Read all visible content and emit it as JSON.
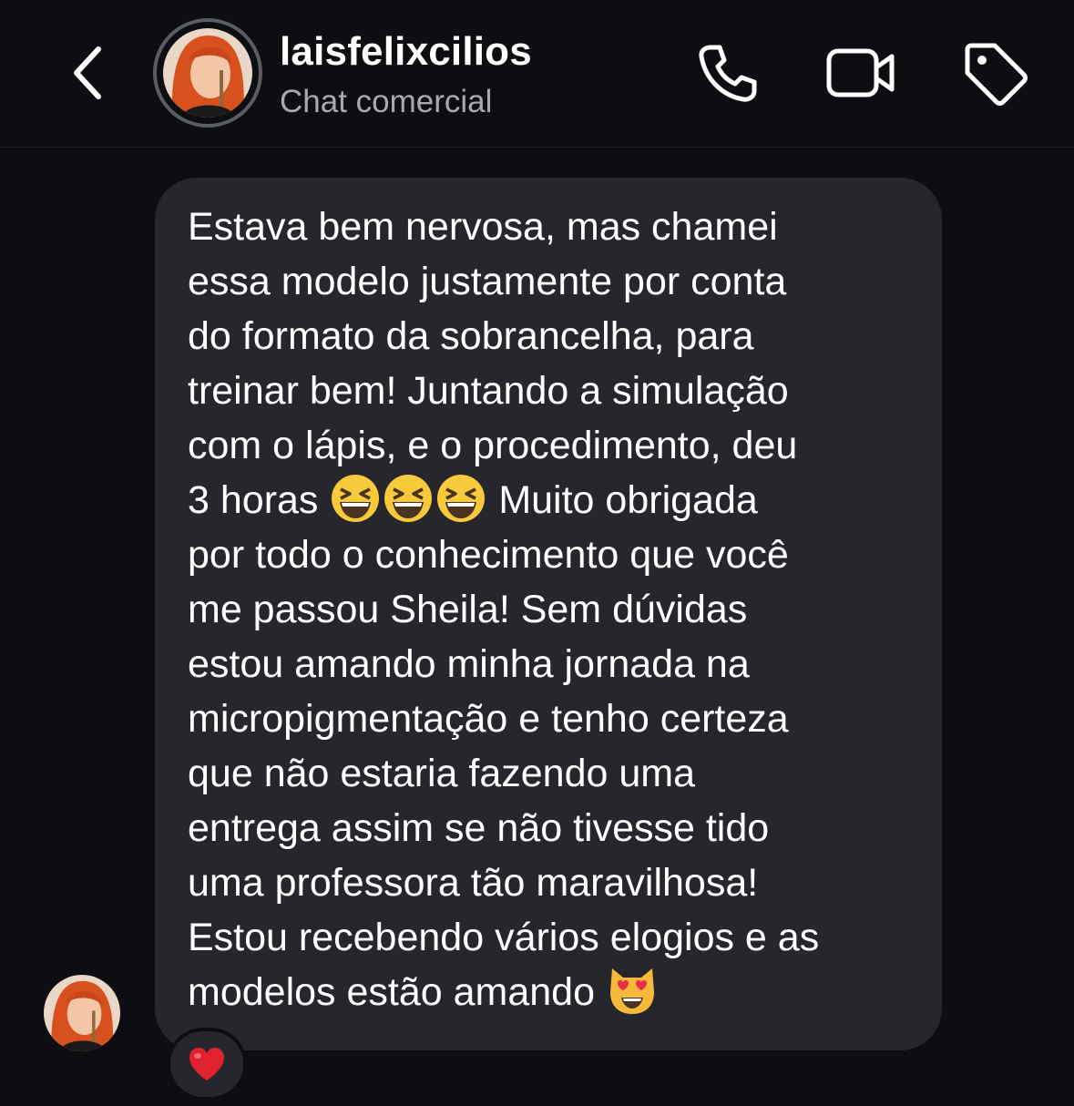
{
  "header": {
    "back_icon": "chevron-left-icon",
    "username": "laisfelixcilios",
    "subtitle": "Chat comercial",
    "icons": [
      "phone-icon",
      "video-camera-icon",
      "tag-icon"
    ]
  },
  "message": {
    "text_part1": "Estava bem nervosa, mas chamei\nessa modelo justamente por conta\ndo formato da sobrancelha, para\ntreinar bem! Juntando a simulação\ncom o lápis, e o procedimento, deu\n3 horas ",
    "text_part2": " Muito obrigada\npor todo o conhecimento que você\nme passou Sheila! Sem dúvidas\nestou amando minha jornada na\nmicropigmentação e tenho certeza\nque não estaria fazendo uma\nentrega assim se não tivesse tido\numa professora tão maravilhosa!\nEstou recebendo vários elogios e as\nmodelos estão amando ",
    "emojis_inline": [
      "grinning-squinting-face",
      "grinning-squinting-face",
      "grinning-squinting-face"
    ],
    "emoji_end": "smiling-cat-heart-eyes",
    "reaction": "red-heart"
  },
  "colors": {
    "background": "#0d0e12",
    "bubble": "#26272c",
    "text": "#ffffff",
    "subtitle": "#a8a9ae",
    "avatar_hair": "#d8501e"
  }
}
